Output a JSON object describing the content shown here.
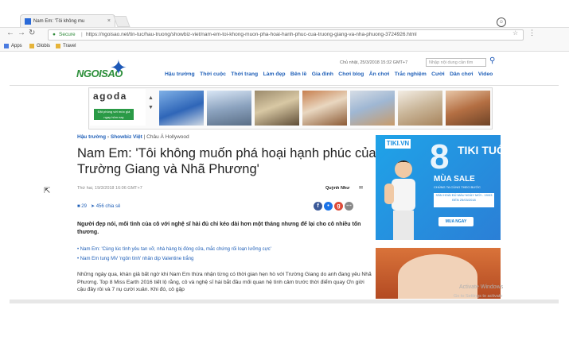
{
  "browser": {
    "tab_title": "Nam Em: 'Tôi không mu",
    "tab_close": "×",
    "secure_label": "Secure",
    "url_separator": "|",
    "url": "https://ngoisao.net/tin-tuc/hau-truong/showbiz-viet/nam-em-toi-khong-muon-pha-hoai-hanh-phuc-cua-truong-giang-va-nha-phuong-3724926.html",
    "bookmarks": [
      "Apps",
      "Globis",
      "Travel"
    ]
  },
  "site": {
    "logo": "NGOISAO",
    "date": "Chủ nhật, 25/3/2018 15:32 GMT+7",
    "search_placeholder": "Nhập nội dung cần tìm",
    "nav": [
      "Hậu trường",
      "Thời cuộc",
      "Thời trang",
      "Làm đẹp",
      "Bên lề",
      "Gia đình",
      "Chơi blog",
      "Ăn chơi",
      "Trắc nghiệm",
      "Cười",
      "Dân chơi",
      "Video"
    ]
  },
  "ad": {
    "brand": "agoda",
    "button": "Đặt phòng với mức giá ngay hôm nay"
  },
  "article": {
    "breadcrumb": [
      "Hậu trường",
      "Showbiz Việt",
      "Châu Á",
      "Hollywood"
    ],
    "title": "Nam Em: 'Tôi không muốn phá hoại hạnh phúc của Trường Giang và Nhã Phương'",
    "meta": "Thứ hai, 19/3/2018 16:06 GMT+7",
    "author": "Quỳnh Như",
    "comments": "29",
    "likes": "456 chia sẻ",
    "sapo": "Người đẹp nói, mối tình của cô với nghệ sĩ hài đủ chỉ kéo dài hơn một tháng nhưng để lại cho cô nhiều tổn thương.",
    "related": [
      "Nam Em: 'Cùng lúc tình yêu tan vỡ, nhà hàng bị đóng cửa, mắc chứng rối loạn lưỡng cực'",
      "Nam Em tung MV 'ngôn tình' nhân dịp Valentine trắng"
    ],
    "body": "Những ngày qua, khán giả bất ngờ khi Nam Em thừa nhận từng có thời gian hẹn hò với Trường Giang do anh đang yêu Nhã Phương. Top 8 Miss Earth 2016 tiết lộ rằng, cô và nghệ sĩ hài bắt đầu mối quan hệ tình cảm trước thời điểm quay Ơn giời cậu đây rồi và 7 nụ cười xuân. Khi đó, cô gặp"
  },
  "tiki": {
    "logo": "TIKI.VN",
    "eight": "8",
    "tuoi": "TIKI TUỔI",
    "sale": "MÙA SALE",
    "sub": "CHÚNG TA CÙNG THEO BƯỚC",
    "band": "SĂN HOÀI ĐỦ MÀU NGÀY MỚI - 19/03 ĐẾN 25/03/2018",
    "button": "MUA NGAY"
  },
  "windows": {
    "line1": "Activate Windows",
    "line2": "Go to Settings to activate"
  }
}
